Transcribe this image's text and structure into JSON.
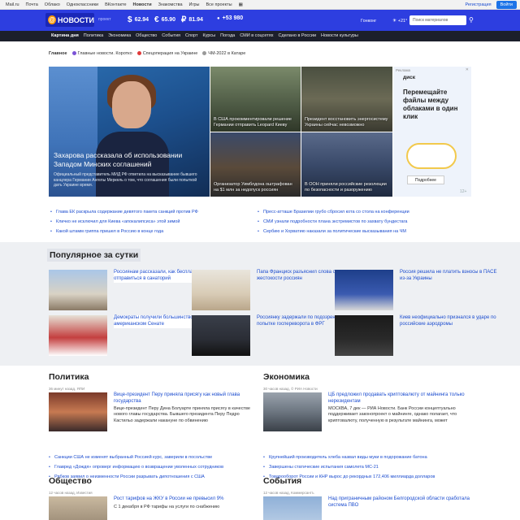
{
  "topbar": {
    "links": [
      "Mail.ru",
      "Почта",
      "Облако",
      "Одноклассники",
      "ВКонтакте",
      "Новости",
      "Знакомства",
      "Игры",
      "Все проекты"
    ],
    "register": "Регистрация",
    "login": "Войти"
  },
  "header": {
    "logo": "НОВОСТИ",
    "proekt": "проект",
    "rates": [
      {
        "sym": "$",
        "value": "62.94"
      },
      {
        "sym": "€",
        "value": "65.90"
      },
      {
        "sym": "₽",
        "value": "81.94"
      },
      {
        "sym": "●",
        "value": "+53 980"
      }
    ],
    "city": "Гонконг",
    "temp": "+21°",
    "search_placeholder": "Поиск материалов"
  },
  "mainnav": [
    "Картина дня",
    "Политика",
    "Экономика",
    "Общество",
    "События",
    "Спорт",
    "Курсы",
    "Погода",
    "СМИ в соцсетях",
    "Сделано в России",
    "Новости культуры"
  ],
  "subnav": [
    {
      "label": "Главное",
      "color": ""
    },
    {
      "label": "Главные новости. Коротко",
      "color": "#7b53d6"
    },
    {
      "label": "Спецоперация на Украине",
      "color": "#e03a3a"
    },
    {
      "label": "ЧМ-2022 в Катаре",
      "color": "#999999"
    }
  ],
  "lead": {
    "title": "Захарова рассказала об использовании Западом Минских соглашений",
    "text": "Официальный представитель МИД РФ ответила на высказывание бывшего канцлера Германии Ангелы Меркель о том, что соглашения были попыткой дать Украине время."
  },
  "tiles": [
    {
      "caption": "В США прокомментировали решение Германии отправить Leopard Киеву"
    },
    {
      "caption": "Президент восстановить энергосистему Украины сейчас невозможно"
    },
    {
      "caption": "Организатор Уимблдона оштрафован на $1 млн за недопуск россиян"
    },
    {
      "caption": "В ООН приняли российские резолюции по безопасности и разоружению"
    }
  ],
  "ad": {
    "label": "Реклама",
    "brand": "диск",
    "headline": "Перемещайте файлы между облаками в один клик",
    "button": "Подробнее",
    "age": "12+"
  },
  "newslinks_left": [
    "Глава ЕК раскрыла содержание девятого пакета санкций против РФ",
    "Кличко не исключил для Киева «апокалипсиса» этой зимой",
    "Какой штамм гриппа пришел в Россию в конце года"
  ],
  "newslinks_right": [
    "Пресс-атташе Бразилии грубо сбросил кота со стола на конференции",
    "СМИ узнали подробности плана экстремистов по захвату бундестага",
    "Сербию и Хорватию наказали за политические высказывания на ЧМ"
  ],
  "popular": {
    "title": "Популярное за сутки",
    "items": [
      "Россиянам рассказали, как бесплатно отправиться в санаторий",
      "Папа Франциск разъяснил слова о жестокости россиян",
      "Россия решила не платить взносы в ПАСЕ из-за Украины",
      "Демократы получили большинство в американском Сенате",
      "Россиянку задержали по подозрению в попытке госпереворота в ФРГ",
      "Киев неофициально признался в ударе по российские аэродромы"
    ]
  },
  "politics": {
    "title": "Политика",
    "meta": "36 минут назад, ЯПИ",
    "headline": "Вице-президент Перу приняла присягу как новый глава государства",
    "lead": "Вице-президент Перу Дина Болуарте приняла присягу в качестве нового главы государства. Бывшего президента Перу Педро Кастильо задержали накануне по обвинению",
    "links": [
      "Санкции США не изменят выбранный Россией курс, заверили в посольстве",
      "Главред «Дождя» опроверг информацию о возвращении уволенных сотрудников",
      "Рябков заявил о неизменности России разрывать дипотношения с США"
    ]
  },
  "economy": {
    "title": "Экономика",
    "meta": "30 часов назад, © РИА Новости",
    "headline": "ЦБ предложил продавать криптовалюту от майнинга только нерезидентам",
    "lead": "МОСКВА, 7 дек — РИА Новости. Банк России концептуально поддерживает законопроект о майнинге, однако полагает, что криптовалюту, полученную в результате майнинга, может",
    "links": [
      "Крупнейший производитель хлеба назвал виды муки в подорожание батона",
      "Завершены статические испытания самолета МС-21",
      "Товарооборот России и КНР вырос до рекордных 172,406 миллиарда долларов"
    ]
  },
  "society": {
    "title": "Общество",
    "meta": "12 часов назад, Известия",
    "headline": "Рост тарифов на ЖКУ в России не превысил 9%",
    "lead": "С 1 декабря в РФ тарифы на услуги по снабжению"
  },
  "events": {
    "title": "События",
    "meta": "12 часов назад, Коммерсантъ",
    "headline": "Над приграничным районом Белгородской области сработала система ПВО",
    "lead": ""
  }
}
